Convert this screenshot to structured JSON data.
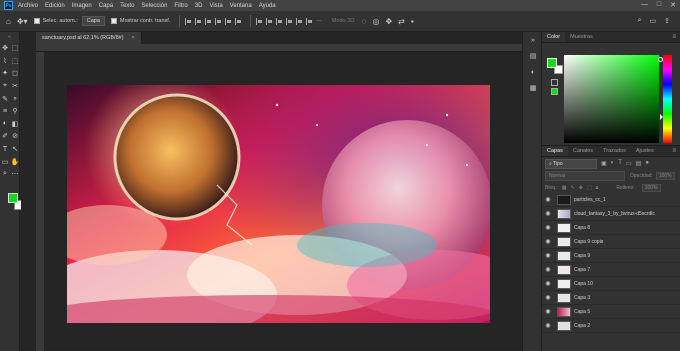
{
  "menu": {
    "logo": "Ps",
    "items": [
      "Archivo",
      "Edición",
      "Imagen",
      "Capa",
      "Texto",
      "Selección",
      "Filtro",
      "3D",
      "Vista",
      "Ventana",
      "Ayuda"
    ],
    "window_controls": [
      "—",
      "□",
      "✕"
    ]
  },
  "options": {
    "autoselect_label": "Selec. autom.:",
    "target_value": "Capa",
    "transform_label": "Mostrar contr. transf.",
    "mode3d_label": "Modo 3D:",
    "right_icons": [
      "⌕",
      "▭",
      "⇪"
    ]
  },
  "document": {
    "tab_title": "sanctuary.psd al 62,1% (RGB/8#)",
    "close_glyph": "×"
  },
  "tools": {
    "fg_color": "#16d71f",
    "bg_color": "#ffffff",
    "icons": [
      "✥",
      "⬚",
      "⌇",
      "⬚",
      "✦",
      "◻",
      "⌖",
      "✂",
      "✎",
      "⚬",
      "≡",
      "⚲",
      "◐",
      "◧",
      "✐",
      "⊘",
      "T",
      "↖",
      "▭",
      "✋",
      "⌕",
      "⋯"
    ]
  },
  "dock": {
    "icons": [
      "▤",
      "◐",
      "▦"
    ]
  },
  "color_panel": {
    "tabs": [
      "Color",
      "Muestras"
    ],
    "active_tab": 0,
    "menu_glyph": "≡"
  },
  "layers_panel": {
    "tabs": [
      "Capas",
      "Canales",
      "Trazados",
      "Ajustes"
    ],
    "active_tab": 0,
    "menu_glyph": "≡",
    "filter_label": "Tipo",
    "blend_mode": "Normal",
    "opacity_label": "Opacidad:",
    "opacity_value": "100%",
    "lock_label": "Bloq.:",
    "fill_label": "Relleno:",
    "fill_value": "100%",
    "layers": [
      {
        "name": "particles_cc_1"
      },
      {
        "name": "cloud_fantasy_3_by_bvirus-d5scrdlc"
      },
      {
        "name": "Capa 8"
      },
      {
        "name": "Capa 9 copia"
      },
      {
        "name": "Capa 9"
      },
      {
        "name": "Capa 7"
      },
      {
        "name": "Capa 10"
      },
      {
        "name": "Capa 3"
      },
      {
        "name": "Capa 5"
      },
      {
        "name": "Capa 2"
      }
    ]
  }
}
